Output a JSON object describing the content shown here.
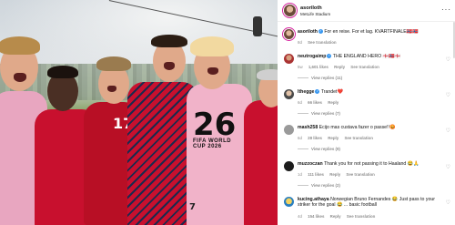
{
  "post": {
    "author": "asoriloth",
    "location": "MetLife Stadium",
    "more_icon": "more-horizontal-icon",
    "badge_text": "FIFA WORLD CUP 2026",
    "badge_year": "26",
    "jersey_numbers": [
      "17",
      "7"
    ]
  },
  "comments": [
    {
      "user": "asoriloth",
      "verified": true,
      "text": "For en reise. For et lag. KVARTFINALE🇳🇴🇳🇴",
      "meta": [
        "8d"
      ],
      "see_translation": "See translation",
      "replies": ""
    },
    {
      "user": "neutrogaimp",
      "verified": true,
      "text": "THE ENGLAND HERO 🏴󠁧󠁢󠁥󠁮󠁧󠁿🇳🇴🏴󠁧󠁢󠁥󠁮󠁧󠁿",
      "meta": [
        "5w",
        "1,601 likes",
        "Reply"
      ],
      "see_translation": "See translation",
      "replies": "View replies (11)"
    },
    {
      "user": "lthegge",
      "verified": true,
      "text": "Trandet❤️",
      "meta": [
        "6d",
        "66 likes",
        "Reply"
      ],
      "see_translation": "",
      "replies": "View replies (7)"
    },
    {
      "user": "mash258",
      "verified": false,
      "text": "Ecijo mas custava fazer o passe!!😡",
      "meta": [
        "6d",
        "28 likes",
        "Reply"
      ],
      "see_translation": "See translation",
      "replies": "View replies (9)"
    },
    {
      "user": "muzzoczan",
      "verified": false,
      "text": "Thank you for not passing it to Haaland 😂🙏",
      "meta": [
        "1d",
        "111 likes",
        "Reply"
      ],
      "see_translation": "See translation",
      "replies": "View replies (2)"
    },
    {
      "user": "kucing.athaya",
      "verified": false,
      "text": "Norwegian Bruno Fernandes 😂 Just pass to your striker for the goal 😂 ... basic football",
      "meta": [
        "4d",
        "154 likes",
        "Reply"
      ],
      "see_translation": "See translation",
      "replies": ""
    }
  ],
  "icons": {
    "heart": "♡",
    "verified": "✓",
    "more": "···"
  },
  "colors": {
    "verified_blue": "#3897f0",
    "meta_gray": "#8e8e8e",
    "norway_red": "#c8102e"
  }
}
